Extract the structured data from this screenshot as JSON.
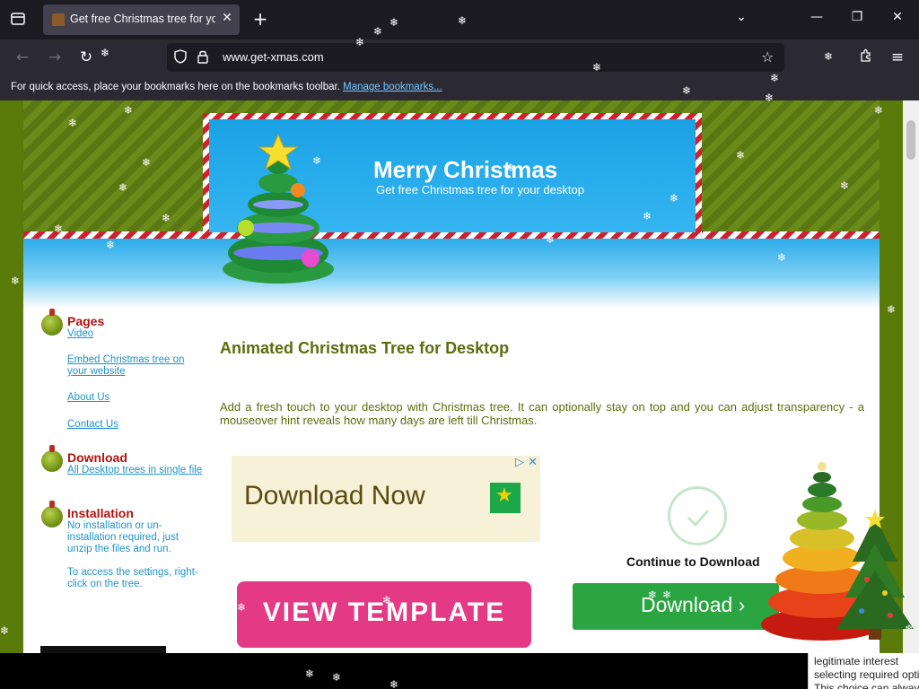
{
  "browser": {
    "tab": {
      "title": "Get free Christmas tree for your desktop"
    },
    "url": {
      "host": "www.get-xmas.com"
    },
    "bookmarks_toolbar": {
      "message": "For quick access, place your bookmarks here on the bookmarks toolbar.",
      "link": "Manage bookmarks..."
    }
  },
  "header": {
    "title": "Merry Christmas",
    "subtitle": "Get free Christmas tree for your desktop"
  },
  "sidebar": {
    "pages": {
      "heading": "Pages",
      "links": [
        "Video",
        "Embed Christmas tree on your website",
        "About Us",
        "Contact Us"
      ]
    },
    "download": {
      "heading": "Download",
      "link": "All Desktop trees in single file"
    },
    "installation": {
      "heading": "Installation",
      "text1": "No installation or un-installation required, just unzip the files and run.",
      "text2": "To access the settings, right-click on the tree."
    }
  },
  "main": {
    "title": "Animated Christmas Tree for Desktop",
    "intro": "Add a fresh touch to your desktop with Christmas tree. It can optionally stay on top and you can adjust transparency - a mouseover hint reveals how many days are left till Christmas."
  },
  "ads": {
    "download_now": "Download Now",
    "continue": "Continue to Download",
    "download_button": "Download ›",
    "view_template": "VIEW TEMPLATE"
  },
  "consent": {
    "lines": [
      "legitimate interest",
      "selecting required opti",
      "This choice can always"
    ]
  },
  "colors": {
    "page_background": "#5a7a0a",
    "heading_red": "#b3120f",
    "link_blue": "#1f94c8",
    "title_green": "#5a6e0c",
    "sky_blue": "#1aa2e6",
    "pink_button": "#e43a86",
    "green_button": "#2aa542"
  },
  "icons": {
    "list_all_tabs": "list-all-tabs-icon",
    "close_tab": "close-icon",
    "new_tab": "plus-icon",
    "back": "back-arrow-icon",
    "forward": "forward-arrow-icon",
    "reload": "reload-icon",
    "shield": "shield-icon",
    "lock": "lock-icon",
    "bookmark_star": "star-icon",
    "extensions": "puzzle-icon",
    "menu": "hamburger-menu-icon"
  }
}
